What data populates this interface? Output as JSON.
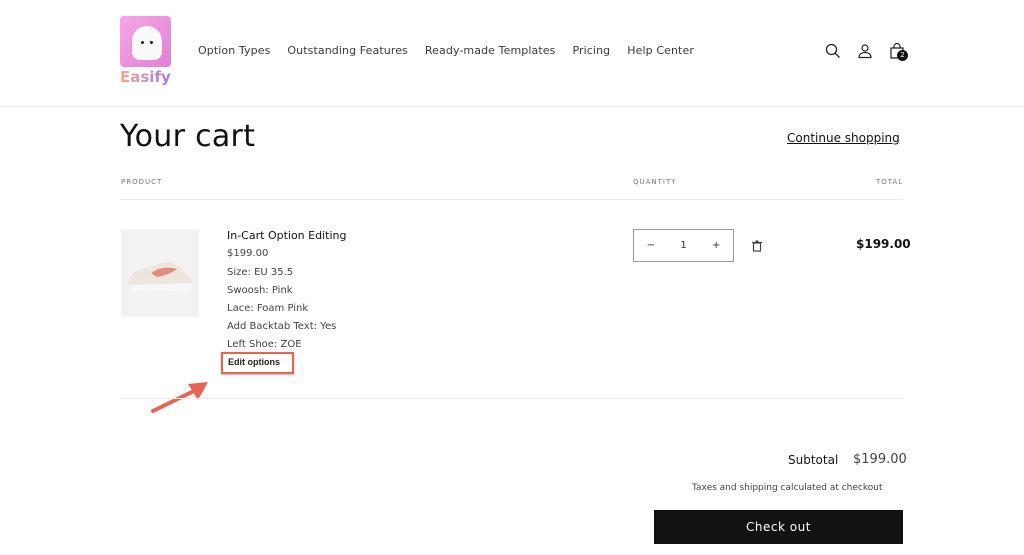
{
  "brand": {
    "name": "Easify"
  },
  "nav": [
    "Option Types",
    "Outstanding Features",
    "Ready-made Templates",
    "Pricing",
    "Help Center"
  ],
  "header_icons": {
    "search": "search-icon",
    "account": "account-icon",
    "cart": "cart-icon",
    "cart_count": "2"
  },
  "page": {
    "title": "Your cart",
    "continue": "Continue shopping"
  },
  "table": {
    "headers": [
      "PRODUCT",
      "QUANTITY",
      "TOTAL"
    ]
  },
  "item": {
    "name": "In-Cart Option Editing",
    "price": "$199.00",
    "options": [
      "Size: EU 35.5",
      "Swoosh: Pink",
      "Lace: Foam Pink",
      "Add Backtab Text: Yes",
      "Left Shoe: ZOE"
    ],
    "edit_label": "Edit options",
    "quantity": "1",
    "minus": "−",
    "plus": "+",
    "total": "$199.00"
  },
  "summary": {
    "subtotal_label": "Subtotal",
    "subtotal": "$199.00",
    "tax_note": "Taxes and shipping calculated at checkout",
    "checkout": "Check out"
  },
  "colors": {
    "accent": "#e86452",
    "button": "#121212"
  }
}
